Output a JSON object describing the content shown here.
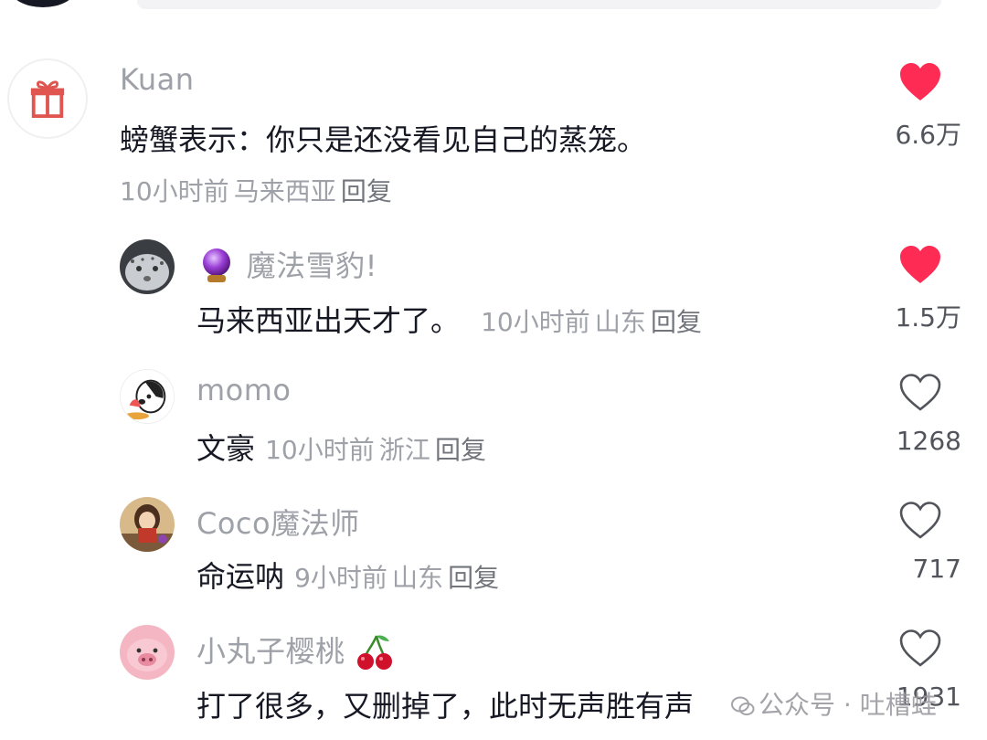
{
  "comments": [
    {
      "username": "Kuan",
      "text": "螃蟹表示：你只是还没看见自己的蒸笼。",
      "time": "10小时前",
      "location": "马来西亚",
      "reply": "回复",
      "likes": "6.6万",
      "liked": true,
      "avatar_icon": "gift-icon"
    },
    {
      "username": "魔法雪豹!",
      "badge_icon": "crystal-ball-icon",
      "text": "马来西亚出天才了。",
      "time": "10小时前",
      "location": "山东",
      "reply": "回复",
      "likes": "1.5万",
      "liked": true,
      "avatar_icon": "snow-leopard-avatar"
    },
    {
      "username": "momo",
      "text": "文豪",
      "time": "10小时前",
      "location": "浙江",
      "reply": "回复",
      "likes": "1268",
      "liked": false,
      "avatar_icon": "cartoon-dog-avatar"
    },
    {
      "username": "Coco魔法师",
      "text": "命运呐",
      "time": "9小时前",
      "location": "山东",
      "reply": "回复",
      "likes": "717",
      "liked": false,
      "avatar_icon": "girl-avatar"
    },
    {
      "username": "小丸子樱桃",
      "badge_icon": "cherry-icon",
      "text": "打了很多，又删掉了，此时无声胜有声",
      "likes": "1931",
      "liked": false,
      "avatar_icon": "pig-avatar"
    }
  ],
  "watermark": "公众号 · 吐槽蛙",
  "colors": {
    "like_red": "#fe2c55",
    "meta_gray": "#9ea1a8",
    "text_dark": "#161823"
  }
}
